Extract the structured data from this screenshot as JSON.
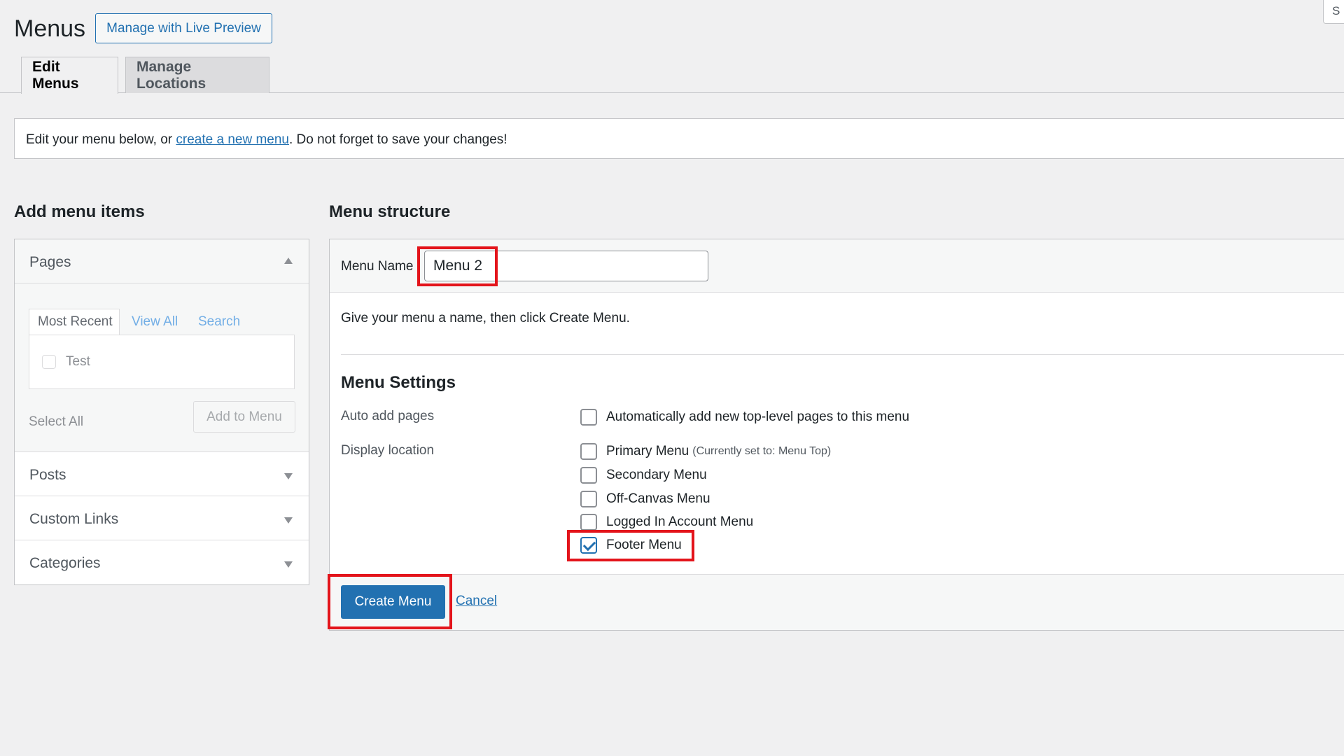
{
  "header": {
    "title": "Menus",
    "live_preview_label": "Manage with Live Preview",
    "screen_options_label": "S"
  },
  "tabs": [
    {
      "label": "Edit Menus",
      "active": true
    },
    {
      "label": "Manage Locations",
      "active": false
    }
  ],
  "notice": {
    "before": "Edit your menu below, or ",
    "link": "create a new menu",
    "after": ". Do not forget to save your changes!"
  },
  "add_items": {
    "heading": "Add menu items",
    "pages": {
      "title": "Pages",
      "subtabs": [
        "Most Recent",
        "View All",
        "Search"
      ],
      "items": [
        "Test"
      ],
      "select_all": "Select All",
      "add_button": "Add to Menu"
    },
    "sections": [
      "Posts",
      "Custom Links",
      "Categories"
    ]
  },
  "structure": {
    "heading": "Menu structure",
    "menu_name_label": "Menu Name",
    "menu_name_value": "Menu 2",
    "instructions": "Give your menu a name, then click Create Menu.",
    "settings_heading": "Menu Settings",
    "auto_add_label": "Auto add pages",
    "auto_add_option": "Automatically add new top-level pages to this menu",
    "display_location_label": "Display location",
    "locations": [
      {
        "label": "Primary Menu",
        "note": "(Currently set to: Menu Top)",
        "checked": false
      },
      {
        "label": "Secondary Menu",
        "note": "",
        "checked": false
      },
      {
        "label": "Off-Canvas Menu",
        "note": "",
        "checked": false
      },
      {
        "label": "Logged In Account Menu",
        "note": "",
        "checked": false
      },
      {
        "label": "Footer Menu",
        "note": "",
        "checked": true
      }
    ],
    "create_button": "Create Menu",
    "cancel_link": "Cancel"
  },
  "colors": {
    "accent": "#2271b1",
    "highlight": "#e3141b"
  }
}
